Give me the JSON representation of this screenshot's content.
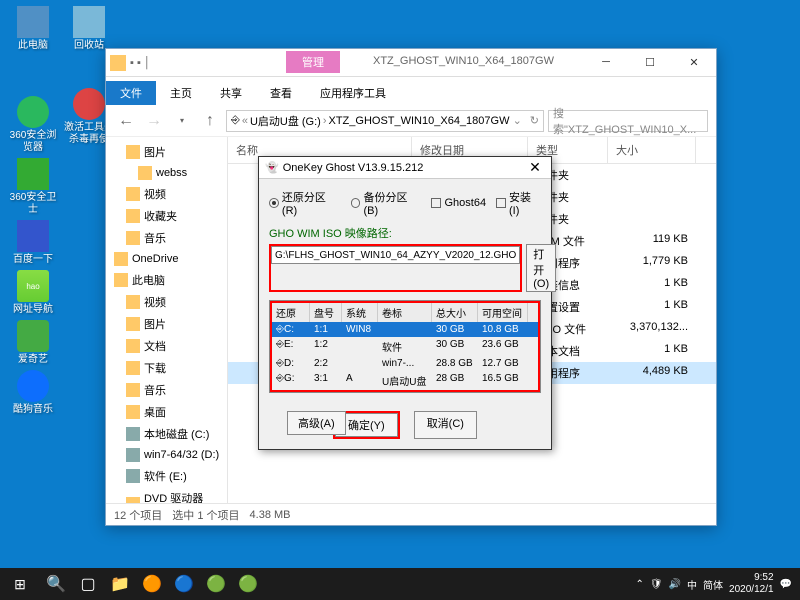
{
  "desktop": {
    "col1": [
      {
        "label": "此电脑"
      },
      {
        "label": "360安全浏览器"
      },
      {
        "label": "360安全卫士"
      },
      {
        "label": "百度一下"
      },
      {
        "label": "网址导航"
      },
      {
        "label": "爱奇艺"
      },
      {
        "label": "酷狗音乐"
      }
    ],
    "col2": [
      {
        "label": "激活工具先杀毒再使"
      }
    ],
    "recycle": "回收站"
  },
  "explorer": {
    "title": "XTZ_GHOST_WIN10_X64_1807GW",
    "ribbon_manage": "管理",
    "tabs": {
      "file": "文件",
      "home": "主页",
      "share": "共享",
      "view": "查看",
      "app": "应用程序工具"
    },
    "breadcrumb": {
      "a": "U启动U盘 (G:)",
      "b": "XTZ_GHOST_WIN10_X64_1807GW"
    },
    "search_placeholder": "搜索\"XTZ_GHOST_WIN10_X...",
    "headers": {
      "name": "名称",
      "date": "修改日期",
      "type": "类型",
      "size": "大小"
    },
    "sidebar": [
      {
        "label": "图片",
        "indent": 1,
        "icon": "folder"
      },
      {
        "label": "webss",
        "indent": 2,
        "icon": "folder"
      },
      {
        "label": "视频",
        "indent": 1,
        "icon": "folder"
      },
      {
        "label": "收藏夹",
        "indent": 1,
        "icon": "star"
      },
      {
        "label": "音乐",
        "indent": 1,
        "icon": "music"
      },
      {
        "label": "OneDrive",
        "indent": 0,
        "icon": "cloud"
      },
      {
        "label": "此电脑",
        "indent": 0,
        "icon": "pc"
      },
      {
        "label": "视频",
        "indent": 1,
        "icon": "folder"
      },
      {
        "label": "图片",
        "indent": 1,
        "icon": "folder"
      },
      {
        "label": "文档",
        "indent": 1,
        "icon": "folder"
      },
      {
        "label": "下载",
        "indent": 1,
        "icon": "folder"
      },
      {
        "label": "音乐",
        "indent": 1,
        "icon": "folder"
      },
      {
        "label": "桌面",
        "indent": 1,
        "icon": "folder"
      },
      {
        "label": "本地磁盘 (C:)",
        "indent": 1,
        "icon": "disk"
      },
      {
        "label": "win7-64/32 (D:)",
        "indent": 1,
        "icon": "disk"
      },
      {
        "label": "软件 (E:)",
        "indent": 1,
        "icon": "disk"
      },
      {
        "label": "DVD 驱动器 (F:)",
        "indent": 1,
        "icon": "dvd"
      },
      {
        "label": "U启动U盘 (G:)",
        "indent": 1,
        "icon": "disk",
        "selected": true
      }
    ],
    "files": [
      {
        "type": "文件夹",
        "size": ""
      },
      {
        "type": "文件夹",
        "size": ""
      },
      {
        "type": "文件夹",
        "size": ""
      },
      {
        "type": "APM 文件",
        "size": "119 KB"
      },
      {
        "type": "应用程序",
        "size": "1,779 KB"
      },
      {
        "type": "安装信息",
        "size": "1 KB"
      },
      {
        "type": "配置设置",
        "size": "1 KB"
      },
      {
        "type": "GHO 文件",
        "size": "3,370,132..."
      },
      {
        "type": "文本文档",
        "size": "1 KB"
      },
      {
        "type": "应用程序",
        "size": "4,489 KB",
        "selected": true
      }
    ],
    "status": {
      "count": "12 个项目",
      "selected": "选中 1 个项目",
      "size": "4.38 MB"
    }
  },
  "onekey": {
    "title": "OneKey Ghost V13.9.15.212",
    "radio_restore": "还原分区(R)",
    "radio_backup": "备份分区(B)",
    "chk_ghost64": "Ghost64",
    "chk_install": "安装(I)",
    "path_label": "GHO WIM ISO 映像路径:",
    "path_value": "G:\\FLHS_GHOST_WIN10_64_AZYY_V2020_12.GHO",
    "open_btn": "打开(O)",
    "drive_headers": {
      "restore": "还原",
      "disk": "盘号",
      "sys": "系统",
      "label": "卷标",
      "total": "总大小",
      "free": "可用空间"
    },
    "drives": [
      {
        "d": "C:",
        "n": "1:1",
        "s": "WIN8",
        "l": "",
        "t": "30 GB",
        "f": "10.8 GB",
        "sel": true
      },
      {
        "d": "E:",
        "n": "1:2",
        "s": "",
        "l": "软件",
        "t": "30 GB",
        "f": "23.6 GB"
      },
      {
        "d": "D:",
        "n": "2:2",
        "s": "",
        "l": "win7-...",
        "t": "28.8 GB",
        "f": "12.7 GB"
      },
      {
        "d": "G:",
        "n": "3:1",
        "s": "A",
        "l": "U启动U盘",
        "t": "28 GB",
        "f": "16.5 GB"
      }
    ],
    "advanced": "高级(A)",
    "ok": "确定(Y)",
    "cancel": "取消(C)"
  },
  "systray": {
    "lang1": "中",
    "lang2": "简体",
    "time": "9:52",
    "date": "2020/12/1"
  }
}
